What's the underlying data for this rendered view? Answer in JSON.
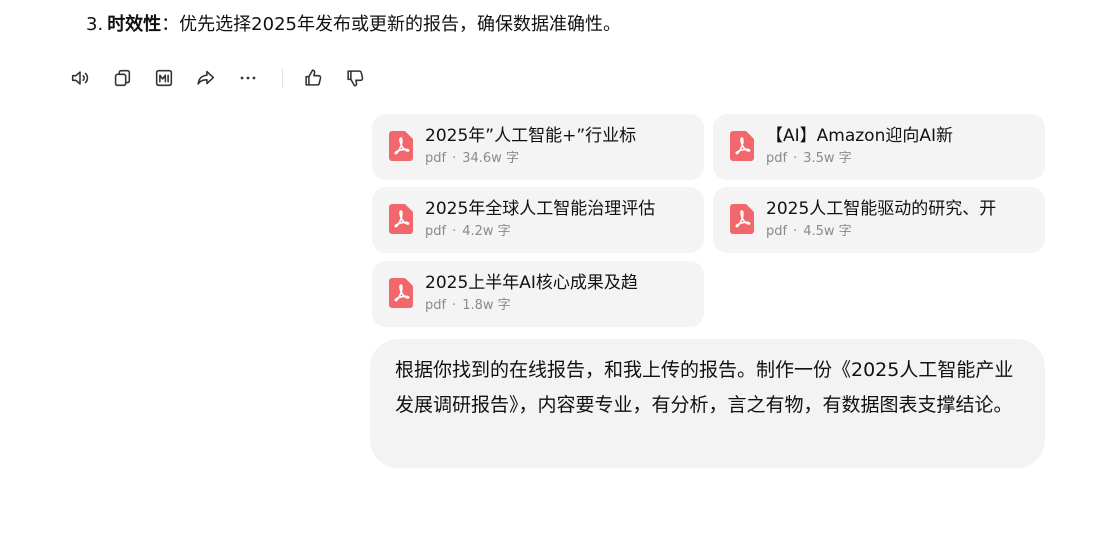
{
  "answer": {
    "point_number": "3.",
    "point_title": "时效性",
    "point_text": "：优先选择2025年发布或更新的报告，确保数据准确性。"
  },
  "actions": [
    {
      "icon": "speaker-icon",
      "label": "朗读"
    },
    {
      "icon": "copy-icon",
      "label": "复制"
    },
    {
      "icon": "chart-icon",
      "label": "图表"
    },
    {
      "icon": "share-icon",
      "label": "分享"
    },
    {
      "icon": "more-icon",
      "label": "更多"
    },
    {
      "icon": "thumbs-up-icon",
      "label": "赞"
    },
    {
      "icon": "thumbs-down-icon",
      "label": "踩"
    }
  ],
  "files": [
    {
      "name": "2025年”人工智能+”行业标",
      "type": "pdf",
      "size": "34.6w 字"
    },
    {
      "name": "【AI】Amazon迎向AI新",
      "type": "pdf",
      "size": "3.5w 字"
    },
    {
      "name": "2025年全球人工智能治理评估",
      "type": "pdf",
      "size": "4.2w 字"
    },
    {
      "name": "2025人工智能驱动的研究、开",
      "type": "pdf",
      "size": "4.5w 字"
    },
    {
      "name": "2025上半年AI核心成果及趋",
      "type": "pdf",
      "size": "1.8w 字"
    }
  ],
  "user_message": "根据你找到的在线报告，和我上传的报告。制作一份《2025人工智能产业发展调研报告》，内容要专业，有分析，言之有物，有数据图表支撑结论。",
  "colors": {
    "pdf_red": "#f2676b",
    "card_bg": "#f4f4f4",
    "bubble_bg": "#f3f3f3",
    "meta_text": "#8a8a8a"
  }
}
